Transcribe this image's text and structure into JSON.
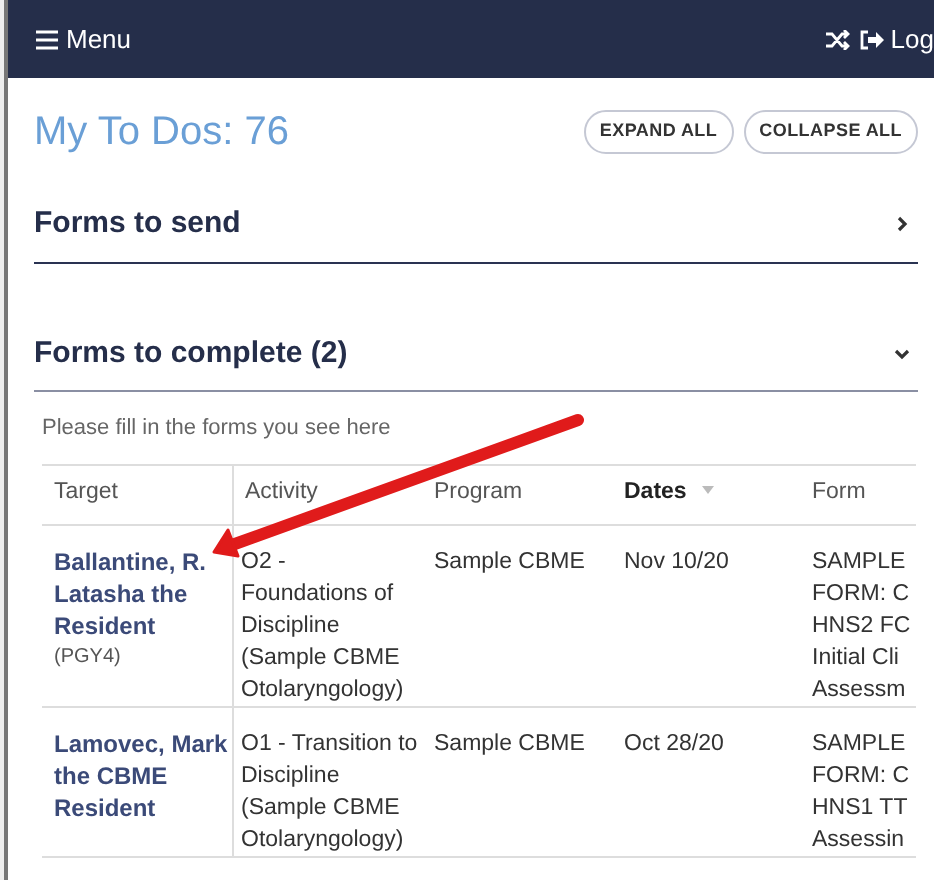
{
  "navbar": {
    "menu_label": "Menu",
    "logout_label": "Log"
  },
  "header": {
    "title": "My To Dos: 76",
    "buttons": [
      "EXPAND ALL",
      "COLLAPSE ALL"
    ]
  },
  "sections": [
    {
      "title": "Forms to send",
      "expanded": false
    },
    {
      "title": "Forms to complete (2)",
      "expanded": true,
      "note": "Please fill in the forms you see here",
      "table": {
        "columns": [
          {
            "label": "Target",
            "sorted": false
          },
          {
            "label": "Activity",
            "sorted": false
          },
          {
            "label": "Program",
            "sorted": false
          },
          {
            "label": "Dates",
            "sorted": true
          },
          {
            "label": "Form",
            "sorted": false
          }
        ],
        "rows": [
          {
            "target": "Ballantine, R. Latasha the Resident",
            "level": "(PGY4)",
            "activity": "O2 - Foundations of Discipline (Sample CBME Otolaryngology)",
            "program": "Sample CBME",
            "date": "Nov 10/20",
            "form_lines": [
              "SAMPLE",
              "FORM: C",
              "HNS2 FC",
              "Initial Cli",
              "Assessm"
            ]
          },
          {
            "target": "Lamovec, Mark the CBME Resident",
            "activity": "O1 - Transition to Discipline (Sample CBME Otolaryngology)",
            "program": "Sample CBME",
            "date": "Oct 28/20",
            "form_lines": [
              "SAMPLE",
              "FORM: C",
              "HNS1 TT",
              "Assessin"
            ]
          }
        ]
      }
    }
  ]
}
